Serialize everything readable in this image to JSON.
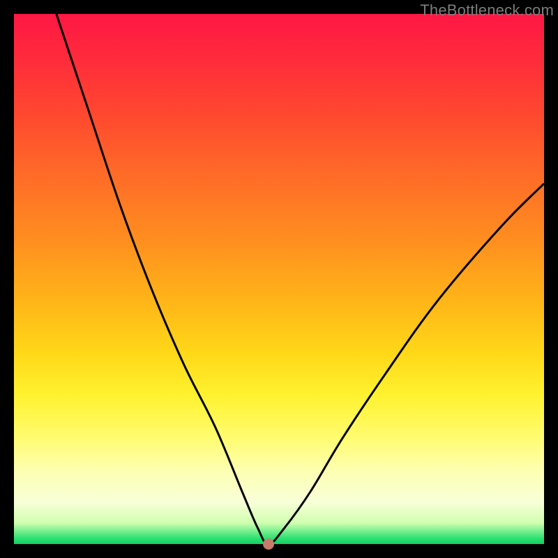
{
  "watermark": "TheBottleneck.com",
  "colors": {
    "frame": "#000000",
    "curve": "#000000",
    "marker": "#c97a6a",
    "gradient_top": "#ff1744",
    "gradient_mid": "#ffd818",
    "gradient_bottom": "#18cc60"
  },
  "chart_data": {
    "type": "line",
    "title": "",
    "xlabel": "",
    "ylabel": "",
    "xlim": [
      0,
      100
    ],
    "ylim": [
      0,
      100
    ],
    "grid": false,
    "legend": false,
    "annotations": [
      {
        "name": "marker",
        "x": 48,
        "y": 0
      }
    ],
    "series": [
      {
        "name": "bottleneck-curve",
        "x": [
          8,
          14,
          20,
          26,
          32,
          38,
          43,
          46,
          48,
          51,
          56,
          62,
          70,
          80,
          92,
          100
        ],
        "y": [
          100,
          82,
          64,
          48,
          34,
          22,
          10,
          3,
          0,
          3,
          10,
          20,
          32,
          46,
          60,
          68
        ]
      }
    ]
  }
}
